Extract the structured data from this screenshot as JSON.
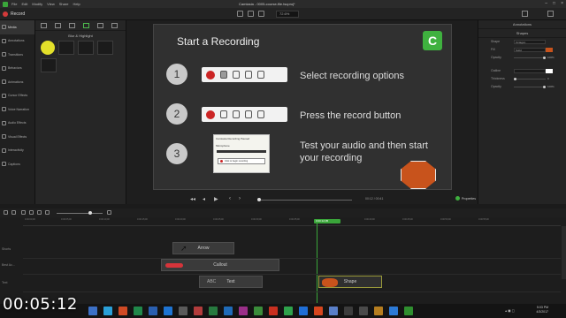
{
  "window": {
    "menus": [
      "File",
      "Edit",
      "Modify",
      "View",
      "Share",
      "Help"
    ],
    "title": "Camtasia - 0005-course-file.tscproj*",
    "controls": [
      "–",
      "□",
      "×"
    ]
  },
  "toolbar": {
    "record_label": "Record",
    "zoom_value": "72.6%"
  },
  "sidebar": {
    "items": [
      {
        "label": "Media",
        "icon": "media-icon"
      },
      {
        "label": "Annotations",
        "icon": "annotation-icon"
      },
      {
        "label": "Transitions",
        "icon": "transition-icon"
      },
      {
        "label": "Behaviors",
        "icon": "behavior-icon"
      },
      {
        "label": "Animations",
        "icon": "animation-icon"
      },
      {
        "label": "Cursor Effects",
        "icon": "cursor-icon"
      },
      {
        "label": "Voice Narration",
        "icon": "microphone-icon"
      },
      {
        "label": "Audio Effects",
        "icon": "audio-icon"
      },
      {
        "label": "Visual Effects",
        "icon": "effects-icon"
      },
      {
        "label": "Interactivity",
        "icon": "interactive-icon"
      },
      {
        "label": "Captions",
        "icon": "caption-icon"
      }
    ]
  },
  "toolpanel": {
    "title": "Blur & Highlight"
  },
  "slide": {
    "title": "Start a Recording",
    "logo_letter": "C",
    "steps": [
      {
        "num": "1",
        "text": "Select recording options"
      },
      {
        "num": "2",
        "text": "Press the record button"
      },
      {
        "num": "3",
        "text": "Test your audio and then start your recording"
      }
    ],
    "popup": {
      "header": "Camtasia Recording Paused",
      "field": "Microphone",
      "button": "Click to begin recording"
    }
  },
  "playback": {
    "time": "00:12 / 00:41",
    "properties_label": "Properties"
  },
  "properties": {
    "tab": "Annotations",
    "section": "Shapes",
    "rows": [
      {
        "label": "Shape",
        "value": "Octagon"
      },
      {
        "label": "Fill",
        "value": "Solid"
      },
      {
        "label": "Opacity",
        "value": "100%"
      },
      {
        "label": "Outline",
        "value": ""
      },
      {
        "label": "Thickness",
        "value": "0"
      },
      {
        "label": "Opacity",
        "value": "100%"
      }
    ]
  },
  "timeline": {
    "playhead_time": "0:00:12;05",
    "ticks": [
      "0:00:00;00",
      "0:00:05;00",
      "0:00:10;00",
      "0:00:15;00",
      "0:00:20;00",
      "0:00:25;00",
      "0:00:30;00",
      "0:00:35;00",
      "0:00:40;00",
      "0:00:45;00",
      "0:00:50;00",
      "0:00:55;00"
    ],
    "tracks": [
      "Shorts",
      "Best Ac...",
      "Text"
    ],
    "clips": [
      {
        "label": "Arrow"
      },
      {
        "label": "Callout"
      },
      {
        "label": "Text"
      },
      {
        "label": "Shape"
      }
    ]
  },
  "taskbar": {
    "time": "5:03 PM",
    "date": "4/3/2017",
    "icon_colors": [
      "#3c70c6",
      "#2aa0d8",
      "#d04a24",
      "#20884a",
      "#2a5fb0",
      "#1e74d2",
      "#5a5a5a",
      "#b23c3c",
      "#277a3f",
      "#1f6bb8",
      "#9a2f88",
      "#3a8c3a",
      "#c93020",
      "#2ea24b",
      "#1f6ed6",
      "#d7461e",
      "#5a7fc8",
      "#3c3c3c",
      "#4a4a4a",
      "#b57d1f",
      "#2c7ad6",
      "#2f8f2f"
    ]
  },
  "overlay": {
    "timestamp": "00:05:12"
  },
  "colors": {
    "accent_green": "#3fb13f",
    "record_red": "#cc2525",
    "shape_orange": "#c8531c"
  }
}
